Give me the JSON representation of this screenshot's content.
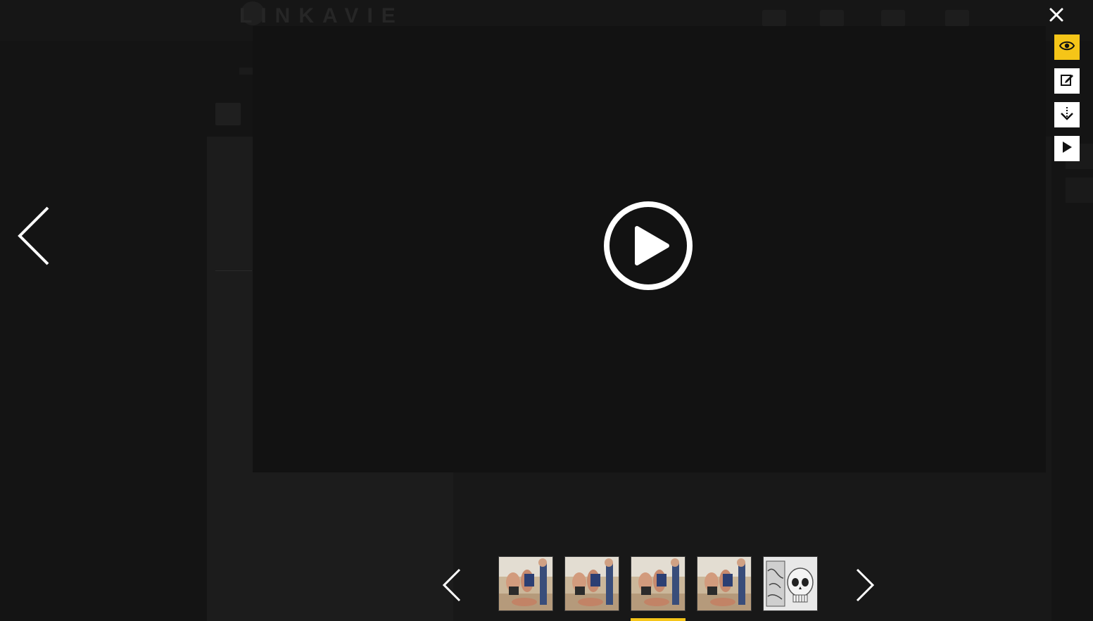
{
  "background_page": {
    "logo_text": "LINKAVIE"
  },
  "lightbox": {
    "toolbar": {
      "close_icon": "close-icon",
      "buttons": [
        {
          "name": "view-button",
          "icon": "eye-icon",
          "active": true
        },
        {
          "name": "edit-button",
          "icon": "edit-icon",
          "active": false
        },
        {
          "name": "download-button",
          "icon": "download-icon",
          "active": false
        },
        {
          "name": "slideshow-button",
          "icon": "play-icon",
          "active": false
        }
      ]
    },
    "video": {
      "play_icon": "play-circle-icon"
    },
    "thumbnails": [
      {
        "kind": "photo-beach"
      },
      {
        "kind": "photo-beach"
      },
      {
        "kind": "photo-beach",
        "selected": true
      },
      {
        "kind": "photo-beach"
      },
      {
        "kind": "illustration-skull"
      }
    ],
    "colors": {
      "accent": "#f5c518",
      "overlay": "#121212",
      "icon": "#ffffff"
    }
  }
}
